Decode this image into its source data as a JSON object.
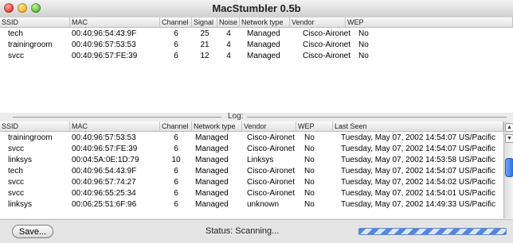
{
  "window": {
    "title": "MacStumbler 0.5b"
  },
  "networks": {
    "columns": [
      "SSID",
      "MAC",
      "Channel",
      "Signal",
      "Noise",
      "Network type",
      "Vendor",
      "WEP"
    ],
    "rows": [
      [
        "tech",
        "00:40:96:54:43:9F",
        "6",
        "25",
        "4",
        "Managed",
        "Cisco-Aironet",
        "No"
      ],
      [
        "trainingroom",
        "00:40:96:57:53:53",
        "6",
        "21",
        "4",
        "Managed",
        "Cisco-Aironet",
        "No"
      ],
      [
        "svcc",
        "00:40:96:57:FE:39",
        "6",
        "12",
        "4",
        "Managed",
        "Cisco-Aironet",
        "No"
      ]
    ]
  },
  "log": {
    "label": "Log:",
    "columns": [
      "SSID",
      "MAC",
      "Channel",
      "Network type",
      "Vendor",
      "WEP",
      "Last Seen"
    ],
    "rows": [
      [
        "trainingroom",
        "00:40:96:57:53:53",
        "6",
        "Managed",
        "Cisco-Aironet",
        "No",
        "Tuesday, May 07, 2002 14:54:07 US/Pacific"
      ],
      [
        "svcc",
        "00:40:96:57:FE:39",
        "6",
        "Managed",
        "Cisco-Aironet",
        "No",
        "Tuesday, May 07, 2002 14:54:07 US/Pacific"
      ],
      [
        "linksys",
        "00:04:5A:0E:1D:79",
        "10",
        "Managed",
        "Linksys",
        "No",
        "Tuesday, May 07, 2002 14:53:58 US/Pacific"
      ],
      [
        "tech",
        "00:40:96:54:43:9F",
        "6",
        "Managed",
        "Cisco-Aironet",
        "No",
        "Tuesday, May 07, 2002 14:54:07 US/Pacific"
      ],
      [
        "svcc",
        "00:40:96:57:74:27",
        "6",
        "Managed",
        "Cisco-Aironet",
        "No",
        "Tuesday, May 07, 2002 14:54:02 US/Pacific"
      ],
      [
        "svcc",
        "00:40:96:55:25:34",
        "6",
        "Managed",
        "Cisco-Aironet",
        "No",
        "Tuesday, May 07, 2002 14:54:01 US/Pacific"
      ],
      [
        "linksys",
        "00:06:25:51:6F:96",
        "6",
        "Managed",
        "unknown",
        "No",
        "Tuesday, May 07, 2002 14:49:33 US/Pacific"
      ]
    ]
  },
  "footer": {
    "save_label": "Save...",
    "status_text": "Status: Scanning..."
  }
}
